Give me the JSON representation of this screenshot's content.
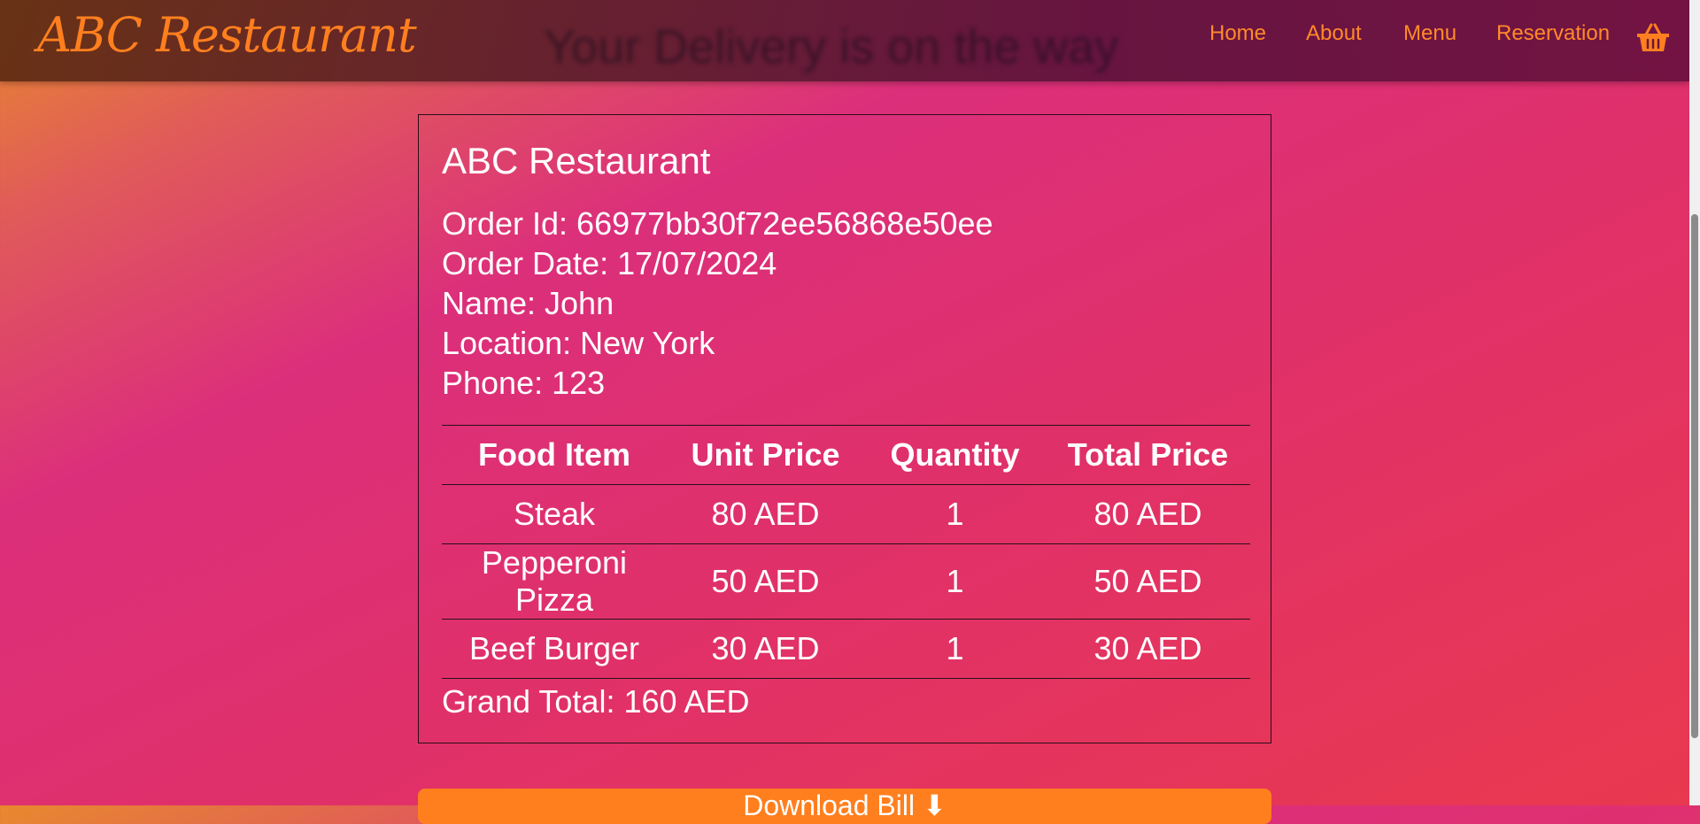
{
  "navbar": {
    "brand": "ABC Restaurant",
    "hero_text": "Your Delivery is on the way",
    "links": [
      "Home",
      "About",
      "Menu",
      "Reservation"
    ],
    "cart_icon": "basket-icon",
    "brand_color": "#ff7f1f"
  },
  "receipt": {
    "title": "ABC Restaurant",
    "order_id": "Order Id: 66977bb30f72ee56868e50ee",
    "order_date": "Order Date: 17/07/2024",
    "name": "Name: John",
    "location": "Location: New York",
    "phone": "Phone: 123",
    "columns": [
      "Food Item",
      "Unit Price",
      "Quantity",
      "Total Price"
    ],
    "rows": [
      [
        "Steak",
        "80 AED",
        "1",
        "80 AED"
      ],
      [
        "Pepperoni Pizza",
        "50 AED",
        "1",
        "50 AED"
      ],
      [
        "Beef Burger",
        "30 AED",
        "1",
        "30 AED"
      ]
    ],
    "grand_total": "Grand Total: 160 AED"
  },
  "download": {
    "label": "Download Bill",
    "icon": "download-icon"
  }
}
